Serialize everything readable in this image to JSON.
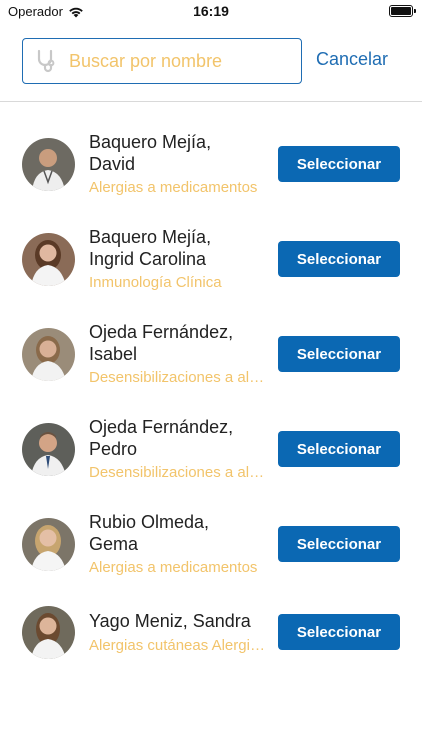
{
  "status_bar": {
    "carrier": "Operador",
    "time": "16:19"
  },
  "search": {
    "placeholder": "Buscar por nombre",
    "value": "",
    "cancel_label": "Cancelar"
  },
  "colors": {
    "accent": "#0b68b3",
    "link": "#1f6db3",
    "specialty": "#f2c46b"
  },
  "doctors": [
    {
      "name_line1": "Baquero Mejía,",
      "name_line2": "David",
      "specialty": "Alergias a medicamentos",
      "button": "Seleccionar"
    },
    {
      "name_line1": "Baquero Mejía,",
      "name_line2": "Ingrid Carolina",
      "specialty": "Inmunología Clínica",
      "button": "Seleccionar"
    },
    {
      "name_line1": "Ojeda Fernández,",
      "name_line2": "Isabel",
      "specialty": "Desensibilizaciones a alimentos",
      "button": "Seleccionar"
    },
    {
      "name_line1": "Ojeda Fernández,",
      "name_line2": "Pedro",
      "specialty": "Desensibilizaciones a alimentos",
      "button": "Seleccionar"
    },
    {
      "name_line1": "Rubio Olmeda,",
      "name_line2": "Gema",
      "specialty": "Alergias a medicamentos",
      "button": "Seleccionar"
    },
    {
      "name_line1": "Yago Meniz, Sandra",
      "name_line2": "",
      "specialty": "Alergias cutáneas   Alergias a medicamentos",
      "button": "Seleccionar"
    }
  ]
}
